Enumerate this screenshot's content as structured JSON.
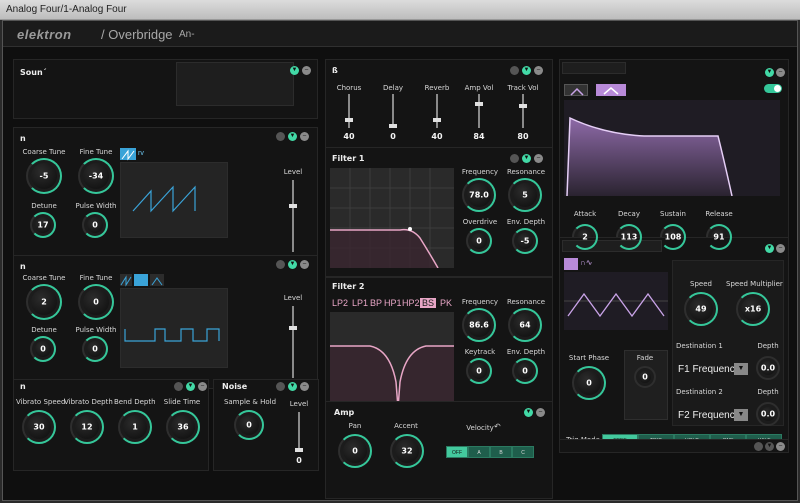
{
  "window_title": "Analog Four/1-Analog Four",
  "brand": {
    "logo": "elektron",
    "product": "/ Overbridge",
    "device": "An-"
  },
  "sound": {
    "header": "Soun´"
  },
  "fx": {
    "header": "ß",
    "labels": [
      "Chorus",
      "Delay",
      "Reverb",
      "Amp Vol",
      "Track Vol"
    ],
    "values": [
      "40",
      "0",
      "40",
      "84",
      "80"
    ]
  },
  "osc1": {
    "header": "n",
    "coarse_label": "Coarse Tune",
    "coarse_value": "-5",
    "fine_label": "Fine Tune",
    "fine_value": "-34",
    "detune_label": "Detune",
    "detune_value": "17",
    "pw_label": "Pulse Width",
    "pw_value": "0",
    "wave_label": "rv",
    "level_label": "Level",
    "level_value": "84"
  },
  "osc2": {
    "header": "n",
    "coarse_label": "Coarse Tune",
    "coarse_value": "2",
    "fine_label": "Fine Tune",
    "fine_value": "0",
    "detune_label": "Detune",
    "detune_value": "0",
    "pw_label": "Pulse Width",
    "pw_value": "0",
    "level_label": "Level",
    "level_value": "88"
  },
  "vibrato": {
    "header": "n",
    "speed_label": "Vibrato Speed",
    "speed_value": "30",
    "depth_label": "Vibrato Depth",
    "depth_value": "12",
    "bend_label": "Bend Depth",
    "bend_value": "1",
    "slide_label": "Slide Time",
    "slide_value": "36"
  },
  "noise": {
    "header": "Noise",
    "sh_label": "Sample & Hold",
    "sh_value": "0",
    "level_label": "Level",
    "level_value": "0"
  },
  "filter1": {
    "header": "Filter 1",
    "freq_label": "Frequency",
    "freq_value": "78.0",
    "res_label": "Resonance",
    "res_value": "5",
    "od_label": "Overdrive",
    "od_value": "0",
    "env_label": "Env. Depth",
    "env_value": "-5"
  },
  "filter2": {
    "header": "Filter 2",
    "types": [
      "LP2",
      "LP1",
      "BP",
      "HP1",
      "HP2",
      "BS",
      "PK"
    ],
    "active_type": "BS",
    "freq_label": "Frequency",
    "freq_value": "86.6",
    "res_label": "Resonance",
    "res_value": "64",
    "kt_label": "Keytrack",
    "kt_value": "0",
    "env_label": "Env. Depth",
    "env_value": "0"
  },
  "amp": {
    "header": "Amp",
    "pan_label": "Pan",
    "pan_value": "0",
    "accent_label": "Accent",
    "accent_value": "32",
    "velocity_label": "Velocity",
    "vel_options": [
      "OFF",
      "A",
      "B",
      "C"
    ]
  },
  "envelope": {
    "attack_label": "Attack",
    "attack_value": "2",
    "decay_label": "Decay",
    "decay_value": "113",
    "sustain_label": "Sustain",
    "sustain_value": "108",
    "release_label": "Release",
    "release_value": "91"
  },
  "lfo": {
    "start_label": "Start Phase",
    "start_value": "0",
    "fade_label": "Fade",
    "fade_value": "0",
    "speed_label": "Speed",
    "speed_value": "49",
    "mult_label": "Speed Multiplier",
    "mult_value": "x16",
    "dest1_label": "Destination 1",
    "dest1_value": "F1 Frequency",
    "depth1_label": "Depth",
    "depth1_value": "0.0",
    "dest2_label": "Destination 2",
    "dest2_value": "F2 Frequency",
    "depth2_label": "Depth",
    "depth2_value": "0.0",
    "trig_label": "Trig Mode",
    "trig_options": [
      "FREE",
      "TRIG",
      "HOLD",
      "ONE",
      "HALF"
    ],
    "trig_active": "FREE"
  },
  "colors": {
    "accent": "#35c79a",
    "filter_pink": "#e8a6c6",
    "env_purple": "#c9a3e8"
  }
}
